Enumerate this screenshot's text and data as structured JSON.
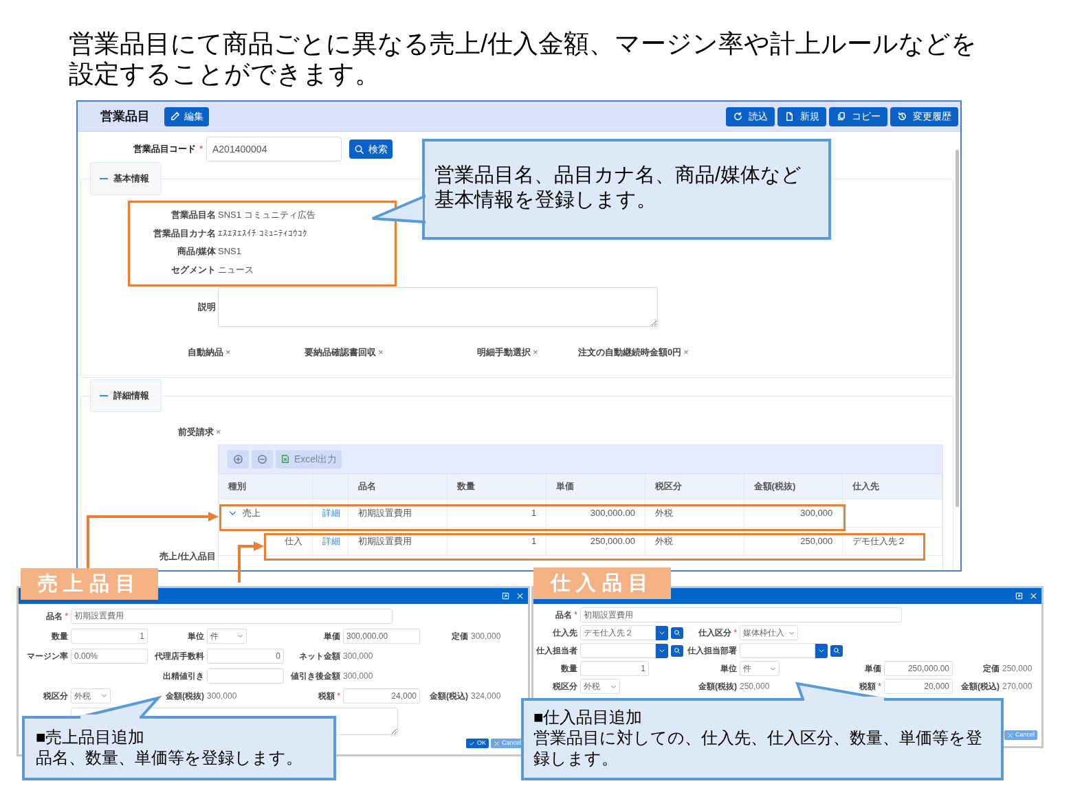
{
  "heading": "営業品目にて商品ごとに異なる売上/仕入金額、マージン率や計上ルールなどを設定することができます。",
  "main_window": {
    "title": "営業品目",
    "edit_button": "編集",
    "toolbar_buttons": [
      "読込",
      "新規",
      "コピー",
      "変更履歴"
    ],
    "code_field": {
      "label": "営業品目コード",
      "required_mark": "*",
      "value": "A201400004"
    },
    "search_button": "検索",
    "basic_section": {
      "title": "基本情報",
      "fields": [
        {
          "label": "営業品目名",
          "value": "SNS1 コミュニティ広告"
        },
        {
          "label": "営業品目カナ名",
          "value": "ｴｽｴﾇｴｽｲﾁ ｺﾐｭﾆﾃｨｺｳｺｸ"
        },
        {
          "label": "商品/媒体",
          "value": "SNS1"
        },
        {
          "label": "セグメント",
          "value": "ニュース"
        }
      ],
      "description_label": "説明",
      "flags": [
        {
          "label": "自動納品",
          "mark": "×"
        },
        {
          "label": "要納品確認書回収",
          "mark": "×"
        },
        {
          "label": "明細手動選択",
          "mark": "×"
        },
        {
          "label": "注文の自動継続時金額0円",
          "mark": "×"
        }
      ]
    },
    "detail_section": {
      "title": "詳細情報",
      "flag": {
        "label": "前受請求",
        "mark": "×"
      },
      "grid_label": "売上/仕入品目",
      "export_button": "Excel出力",
      "columns": [
        "種別",
        "",
        "品名",
        "数量",
        "単価",
        "税区分",
        "金額(税抜)",
        "仕入先"
      ],
      "rows": [
        {
          "type": "売上",
          "link": "詳細",
          "name": "初期設置費用",
          "qty": "1",
          "price": "300,000.00",
          "tax": "外税",
          "amount": "300,000",
          "expanded": true,
          "children": [
            {
              "type": "仕入",
              "link": "詳細",
              "name": "初期設置費用",
              "qty": "1",
              "price": "250,000.00",
              "tax": "外税",
              "amount": "250,000",
              "supplier": "デモ仕入先２"
            }
          ]
        }
      ]
    }
  },
  "sales_tag": "売上品目",
  "purchase_tag": "仕入品目",
  "sales_dialog": {
    "rows": [
      [
        {
          "kind": "input",
          "label": "品名",
          "required_mark": "*",
          "value": "初期設置費用"
        }
      ],
      [
        {
          "kind": "number",
          "label": "数量",
          "value": "1"
        },
        {
          "kind": "select",
          "label": "単位",
          "value": "件"
        },
        {
          "kind": "input",
          "label": "単価",
          "value": "300,000.00"
        },
        {
          "kind": "text",
          "label": "定価",
          "value": "300,000"
        }
      ],
      [
        {
          "kind": "input",
          "label": "マージン率",
          "value": "0.00%"
        },
        {
          "kind": "number",
          "label": "代理店手数料",
          "value": "0"
        },
        {
          "kind": "text",
          "label": "ネット金額",
          "value": "300,000"
        },
        {
          "kind": "blank"
        }
      ],
      [
        {
          "kind": "blank"
        },
        {
          "kind": "input",
          "label": "出精値引き"
        },
        {
          "kind": "text",
          "label": "値引き後金額",
          "value": "300,000"
        },
        {
          "kind": "blank"
        }
      ],
      [
        {
          "kind": "select",
          "label": "税区分",
          "value": "外税"
        },
        {
          "kind": "text",
          "label": "金額(税抜)",
          "value": "300,000"
        },
        {
          "kind": "number",
          "label": "税額",
          "required_mark": "*",
          "value": "24,000"
        },
        {
          "kind": "text",
          "label": "金額(税込)",
          "value": "324,000"
        }
      ],
      [
        {
          "kind": "textarea"
        }
      ]
    ],
    "buttons": [
      {
        "label": "OK",
        "kind": "ok"
      },
      {
        "label": "Cancel",
        "kind": "cancel"
      }
    ]
  },
  "purchase_dialog": {
    "rows": [
      [
        {
          "kind": "input",
          "label": "品名",
          "required_mark": "*",
          "value": "初期設置費用"
        }
      ],
      [
        {
          "kind": "lookup",
          "label": "仕入先",
          "value": "デモ仕入先２"
        },
        {
          "kind": "select",
          "label": "仕入区分",
          "required_mark": "*",
          "value": "媒体枠仕入"
        },
        {
          "kind": "blank"
        },
        {
          "kind": "blank"
        }
      ],
      [
        {
          "kind": "lookup",
          "label": "仕入担当者"
        },
        {
          "kind": "lookup",
          "label": "仕入担当部署"
        }
      ],
      [
        {
          "kind": "number",
          "label": "数量",
          "value": "1"
        },
        {
          "kind": "select",
          "label": "単位",
          "value": "件"
        },
        {
          "kind": "number",
          "label": "単価",
          "value": "250,000.00"
        },
        {
          "kind": "text",
          "label": "定価",
          "value": "250,000"
        }
      ],
      [
        {
          "kind": "select",
          "label": "税区分",
          "value": "外税"
        },
        {
          "kind": "text",
          "label": "金額(税抜)",
          "value": "250,000"
        },
        {
          "kind": "number",
          "label": "税額",
          "required_mark": "*",
          "value": "20,000"
        },
        {
          "kind": "text",
          "label": "金額(税込)",
          "value": "270,000"
        }
      ]
    ],
    "buttons": [
      {
        "label": "Cancel",
        "kind": "cancel"
      }
    ]
  },
  "callouts": [
    {
      "text": "営業品目名、品目カナ名、商品/媒体など基本情報を登録します。"
    },
    {
      "title": "■売上品目追加",
      "text": "品名、数量、単価等を登録します。"
    },
    {
      "title": "■仕入品目追加",
      "text": "営業品目に対しての、仕入先、仕入区分、数量、単価等を登録します。"
    }
  ]
}
